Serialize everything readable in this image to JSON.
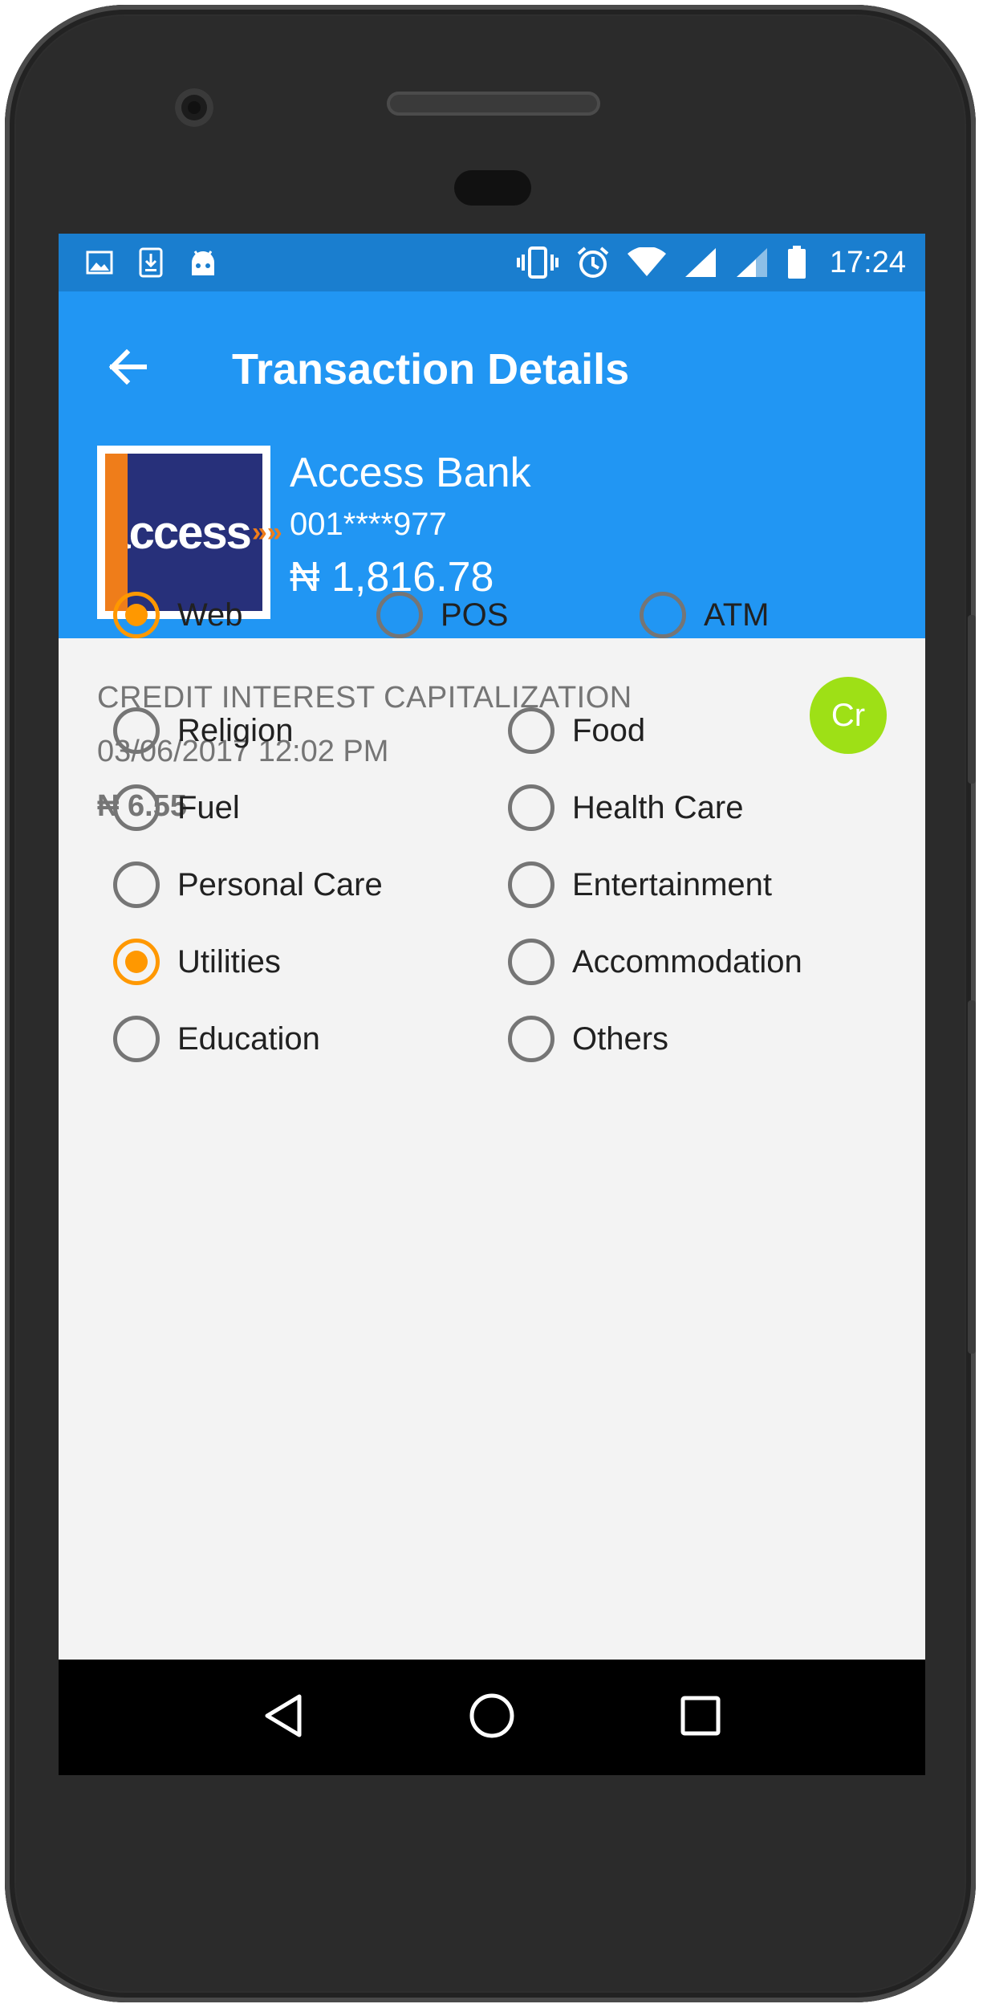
{
  "status_bar": {
    "left_icons": [
      "image-notification-icon",
      "download-notification-icon",
      "android-notification-icon"
    ],
    "right_icons": [
      "vibrate-icon",
      "alarm-icon",
      "wifi-icon",
      "signal-icon",
      "signal-secondary-icon",
      "battery-icon"
    ],
    "time": "17:24"
  },
  "app_bar": {
    "title": "Transaction Details",
    "back_icon": "arrow-back-icon"
  },
  "account": {
    "logo_text": "access",
    "logo_chevrons": "»»",
    "bank_name": "Access Bank",
    "account_number": "001****977",
    "balance": "₦ 1,816.78"
  },
  "transaction": {
    "description": "CREDIT INTEREST CAPITALIZATION",
    "date": "03/06/2017 12:02 PM",
    "amount": "₦ 6.55",
    "type_badge": "Cr"
  },
  "channels": [
    {
      "label": "Web",
      "checked": true
    },
    {
      "label": "POS",
      "checked": false
    },
    {
      "label": "ATM",
      "checked": false
    }
  ],
  "categories": [
    {
      "label": "Religion",
      "checked": false
    },
    {
      "label": "Food",
      "checked": false
    },
    {
      "label": "Fuel",
      "checked": false
    },
    {
      "label": "Health Care",
      "checked": false
    },
    {
      "label": "Personal Care",
      "checked": false
    },
    {
      "label": "Entertainment",
      "checked": false
    },
    {
      "label": "Utilities",
      "checked": true
    },
    {
      "label": "Accommodation",
      "checked": false
    },
    {
      "label": "Education",
      "checked": false
    },
    {
      "label": "Others",
      "checked": false
    }
  ],
  "nav_bar": {
    "icons": [
      "back-triangle-icon",
      "home-circle-icon",
      "recents-square-icon"
    ]
  },
  "colors": {
    "status_bar": "#1a7ecf",
    "app_bar": "#2196f3",
    "radio_checked": "#ff9800",
    "credit_badge": "#9ee016",
    "logo_blue": "#27307a",
    "logo_orange": "#ef7d1a"
  }
}
